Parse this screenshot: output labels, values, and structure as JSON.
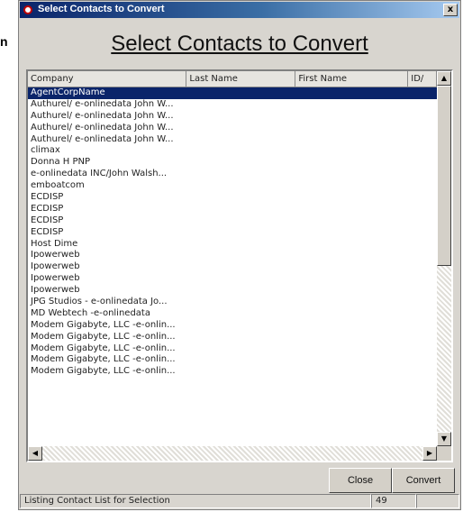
{
  "stray_char": "n",
  "window": {
    "title": "Select Contacts to Convert",
    "close_glyph": "x"
  },
  "heading": "Select Contacts to Convert",
  "columns": [
    "Company",
    "Last Name",
    "First Name",
    "ID/"
  ],
  "rows": [
    "AgentCorpName",
    "Authurel/ e-onlinedata John W...",
    "Authurel/ e-onlinedata John W...",
    "Authurel/ e-onlinedata John W...",
    "Authurel/ e-onlinedata John W...",
    "climax",
    "Donna H PNP",
    "e-onlinedata INC/John Walsh...",
    "emboatcom",
    "ECDISP",
    "ECDISP",
    "ECDISP",
    "ECDISP",
    "Host Dime",
    "Ipowerweb",
    "Ipowerweb",
    "Ipowerweb",
    "Ipowerweb",
    "JPG Studios - e-onlinedata Jo...",
    "MD Webtech -e-onlinedata",
    "Modem Gigabyte, LLC -e-onlin...",
    "Modem Gigabyte, LLC -e-onlin...",
    "Modem Gigabyte, LLC -e-onlin...",
    "Modem Gigabyte, LLC -e-onlin...",
    "Modem Gigabyte, LLC -e-onlin..."
  ],
  "selected_index": 0,
  "scroll": {
    "up": "▲",
    "down": "▼",
    "left": "◀",
    "right": "▶"
  },
  "buttons": {
    "close": "Close",
    "convert": "Convert"
  },
  "status": {
    "message": "Listing Contact List for Selection",
    "count": "49"
  }
}
